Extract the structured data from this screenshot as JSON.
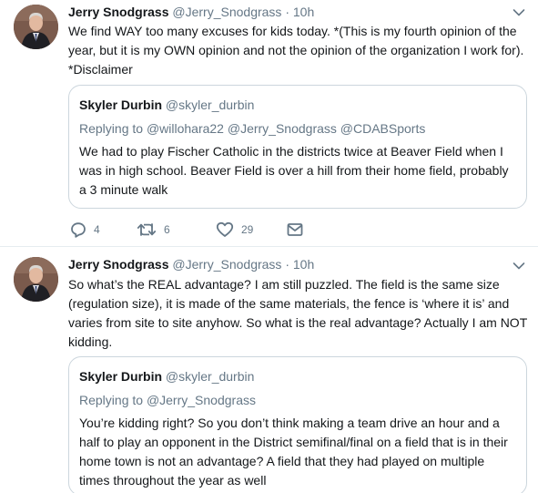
{
  "tweets": [
    {
      "author": {
        "name": "Jerry Snodgrass",
        "handle": "@Jerry_Snodgrass"
      },
      "dot": "·",
      "time": "10h",
      "text": "We find WAY too many excuses for kids today.  *(This is my fourth opinion of the year, but it is my OWN opinion and not the opinion of the organization I work for).  *Disclaimer",
      "quote": {
        "name": "Skyler Durbin",
        "handle": "@skyler_durbin",
        "replying_prefix": "Replying to",
        "replying_to": "@willohara22 @Jerry_Snodgrass @CDABSports",
        "text": "We had to play Fischer Catholic in the districts twice at Beaver Field when I was in high school. Beaver Field is over a hill from their home field, probably a 3 minute walk"
      },
      "actions": {
        "replies": "4",
        "retweets": "6",
        "likes": "29"
      }
    },
    {
      "author": {
        "name": "Jerry Snodgrass",
        "handle": "@Jerry_Snodgrass"
      },
      "dot": "·",
      "time": "10h",
      "text": "So what’s the REAL advantage? I am still puzzled.  The field is the same size (regulation size), it is made of the same materials, the fence is ‘where it is’ and varies from site to site anyhow.  So what is the real advantage?  Actually I am NOT kidding.",
      "quote": {
        "name": "Skyler Durbin",
        "handle": "@skyler_durbin",
        "replying_prefix": "Replying to",
        "replying_to": "@Jerry_Snodgrass",
        "text": "You’re kidding right? So you don’t think making a team drive an hour and a half to play an opponent in the District semifinal/final on a field that is in their home town is not an advantage? A field that they had played on multiple times throughout the year as well"
      }
    }
  ],
  "icons": {
    "reply": "reply-icon",
    "retweet": "retweet-icon",
    "like": "heart-icon",
    "message": "envelope-icon",
    "menu": "chevron-down-icon"
  },
  "colors": {
    "text": "#14171a",
    "secondary": "#657786",
    "border": "#ccd6dd",
    "divider": "#e6ecf0"
  }
}
